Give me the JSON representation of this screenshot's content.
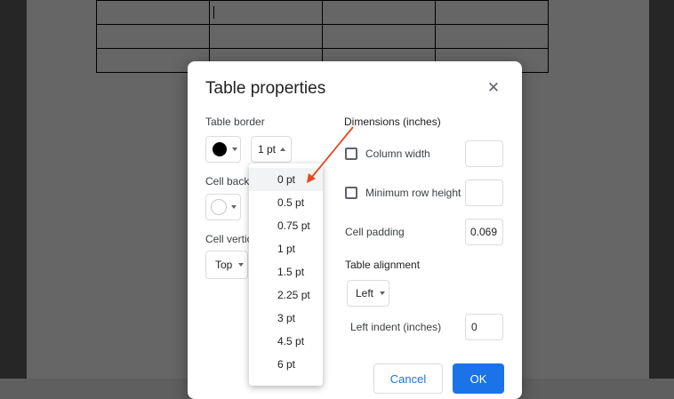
{
  "document": {
    "table_rows": 3,
    "table_cols": 4
  },
  "dialog": {
    "title": "Table properties",
    "close_icon": "close-icon",
    "table_border": {
      "label": "Table border",
      "color": "#000000",
      "width_value": "1 pt"
    },
    "cell_background": {
      "label": "Cell backg",
      "color": "#ffffff"
    },
    "cell_vertical": {
      "label": "Cell vertic",
      "value": "Top"
    },
    "dimensions": {
      "label": "Dimensions  (inches)",
      "column_width_label": "Column width",
      "column_width_value": "",
      "min_row_height_label": "Minimum row height",
      "min_row_height_value": "",
      "cell_padding_label": "Cell padding",
      "cell_padding_value": "0.069"
    },
    "table_alignment": {
      "label": "Table alignment",
      "value": "Left",
      "left_indent_label": "Left indent  (inches)",
      "left_indent_value": "0"
    },
    "buttons": {
      "cancel": "Cancel",
      "ok": "OK"
    }
  },
  "border_width_menu": {
    "items": [
      "0 pt",
      "0.5 pt",
      "0.75 pt",
      "1 pt",
      "1.5 pt",
      "2.25 pt",
      "3 pt",
      "4.5 pt",
      "6 pt"
    ],
    "highlighted": "0 pt"
  },
  "annotation": {
    "arrow_color": "#e8461e"
  }
}
